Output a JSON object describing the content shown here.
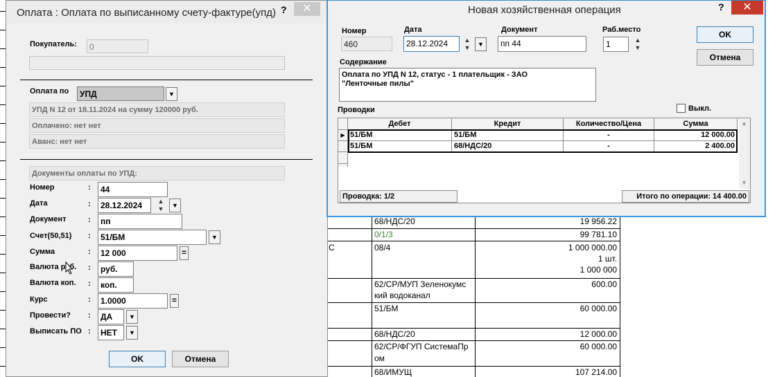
{
  "background_ledger": {
    "rows": [
      {
        "account": "68/НДС/20",
        "amount": "19 956.22"
      },
      {
        "account": "0/1/3",
        "amount": "99 781.10",
        "color": "#3a8a2a"
      },
      {
        "prefix": "С",
        "account": "08/4",
        "amount": "1 000 000.00",
        "amount2": "1 шт.",
        "amount3": "1 000 000"
      },
      {
        "account": "62/СР/МУП Зеленокумс",
        "account2": "кий водоканал",
        "amount": "600.00"
      },
      {
        "account": "51/БМ",
        "amount": "60 000.00"
      },
      {
        "account": "68/НДС/20",
        "amount": "12 000.00"
      },
      {
        "account": "62/СР/ФГУП СистемаПр",
        "account2": "ом",
        "amount": "60 000.00"
      },
      {
        "account": "68/ИМУЩ",
        "amount": "107 214.00"
      }
    ]
  },
  "payment_dialog": {
    "title": "Оплата : Оплата по выписанному счету-фактуре(упд)",
    "help": "?",
    "close": "✕",
    "buyer_label": "Покупатель:",
    "buyer_value": "0",
    "pay_by_label": "Оплата по",
    "pay_by_value": "УПД",
    "upd_info": "УПД N 12 от 18.11.2024 на сумму 120000 руб.",
    "paid_info": "Оплачено: нет нет",
    "advance_info": "Аванс: нет нет",
    "docs_header": "Документы оплаты по УПД:",
    "fields": {
      "number": {
        "label": "Номер",
        "value": "44"
      },
      "date": {
        "label": "Дата",
        "value": "28.12.2024"
      },
      "document": {
        "label": "Документ",
        "value": "пп"
      },
      "account": {
        "label": "Счет(50,51)",
        "value": "51/БМ"
      },
      "sum": {
        "label": "Сумма",
        "value": "12 000"
      },
      "currency_rub": {
        "label": "Валюта руб.",
        "value": "руб."
      },
      "currency_kop": {
        "label": "Валюта коп.",
        "value": "коп."
      },
      "rate": {
        "label": "Курс",
        "value": "1.0000"
      },
      "post": {
        "label": "Провести?",
        "value": "ДА"
      },
      "issue_po": {
        "label": "Выписать ПО",
        "value": "НЕТ"
      }
    },
    "ok": "OK",
    "cancel": "Отмена"
  },
  "operation_dialog": {
    "title": "Новая хозяйственная операция",
    "help": "?",
    "close": "✕",
    "number_label": "Номер",
    "number_value": "460",
    "date_label": "Дата",
    "date_value": "28.12.2024",
    "document_label": "Документ",
    "document_value": "пп 44",
    "workplace_label": "Раб.место",
    "workplace_value": "1",
    "content_label": "Содержание",
    "content_line1": "Оплата по УПД N 12, статус - 1 плательщик - ЗАО",
    "content_line2": "\"Ленточные пилы\"",
    "ok": "OK",
    "cancel": "Отмена",
    "postings_label": "Проводки",
    "off_label": "Выкл.",
    "columns": [
      "Дебет",
      "Кредит",
      "Количество/Цена",
      "Сумма"
    ],
    "rows": [
      {
        "debit": "51/БМ",
        "credit": "51/БМ",
        "qty": "-",
        "sum": "12 000.00"
      },
      {
        "debit": "51/БМ",
        "credit": "68/НДС/20",
        "qty": "-",
        "sum": "2 400.00"
      }
    ],
    "status_left": "Проводка: 1/2",
    "status_right": "Итого по операции: 14 400.00"
  }
}
